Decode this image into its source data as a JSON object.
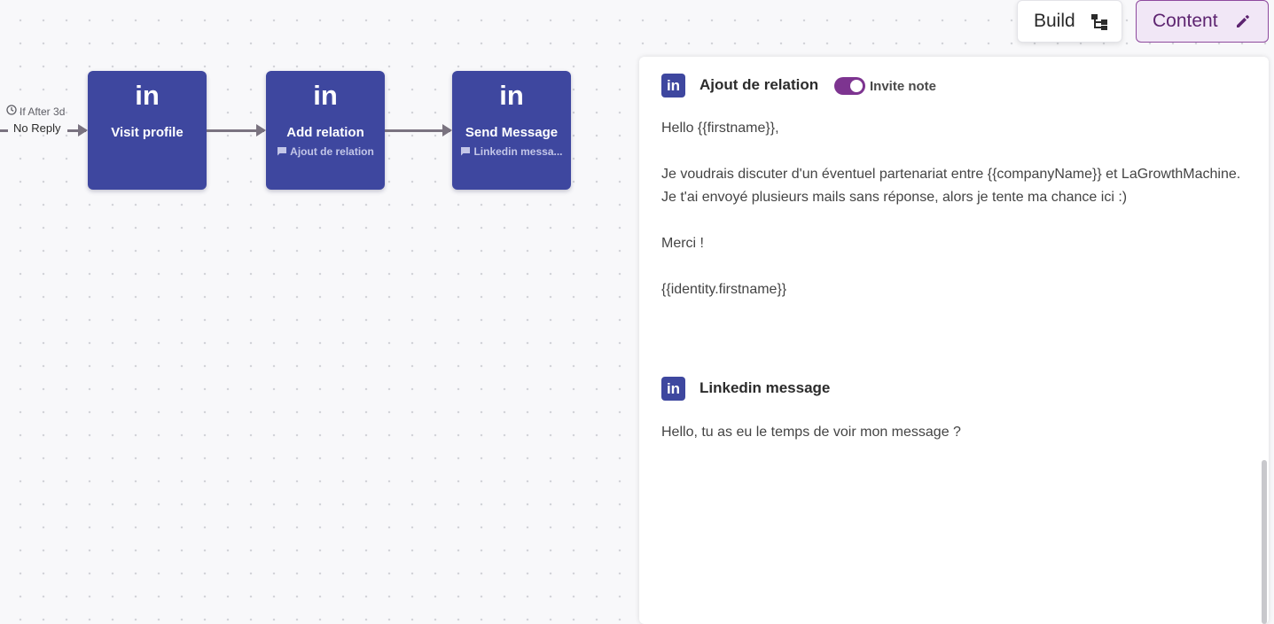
{
  "toolbar": {
    "build_label": "Build",
    "build_icon": "flowchart-icon",
    "content_label": "Content",
    "content_icon": "pencil-icon"
  },
  "workflow": {
    "delay_label": "If After 3d",
    "branch_label": "No Reply",
    "nodes": [
      {
        "logo": "in",
        "title": "Visit profile",
        "subtitle": ""
      },
      {
        "logo": "in",
        "title": "Add relation",
        "subtitle": "Ajout de relation"
      },
      {
        "logo": "in",
        "title": "Send Message",
        "subtitle": "Linkedin messa..."
      }
    ]
  },
  "panel": {
    "sections": [
      {
        "logo": "in",
        "title": "Ajout de relation",
        "toggle_label": "Invite note",
        "toggle_on": true,
        "lines": [
          "Hello {{firstname}},",
          "",
          "Je voudrais discuter d'un éventuel partenariat entre {{companyName}} et LaGrowthMachine. Je t'ai envoyé plusieurs mails sans réponse, alors je tente ma chance ici :)",
          "",
          "Merci !",
          "",
          "{{identity.firstname}}"
        ]
      },
      {
        "logo": "in",
        "title": "Linkedin message",
        "lines": [
          "Hello, tu as eu le temps de voir mon message ?"
        ]
      }
    ]
  },
  "colors": {
    "node_bg": "#3e479f",
    "accent_purple": "#7d3490",
    "content_btn_bg": "#f1e7f6",
    "arrow": "#7a7380"
  }
}
